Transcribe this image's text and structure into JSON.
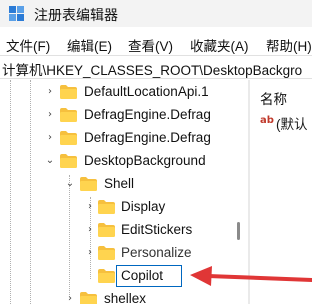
{
  "window": {
    "title": "注册表编辑器"
  },
  "menu": [
    {
      "label": "文件(F)"
    },
    {
      "label": "编辑(E)"
    },
    {
      "label": "查看(V)"
    },
    {
      "label": "收藏夹(A)"
    },
    {
      "label": "帮助(H)"
    }
  ],
  "address": {
    "path": "计算机\\HKEY_CLASSES_ROOT\\DesktopBackgro"
  },
  "tree": {
    "items": [
      {
        "label": "DefaultLocationApi.1"
      },
      {
        "label": "DefragEngine.Defrag"
      },
      {
        "label": "DefragEngine.Defrag"
      },
      {
        "label": "DesktopBackground"
      },
      {
        "label": "Shell"
      },
      {
        "label": "Display"
      },
      {
        "label": "EditStickers"
      },
      {
        "label": "Personalize"
      },
      {
        "label": "Copilot"
      },
      {
        "label": "shellex"
      }
    ]
  },
  "values_pane": {
    "header_name": "名称",
    "rows": [
      {
        "icon": "string-value-icon",
        "name": "(默认"
      }
    ]
  },
  "colors": {
    "folder": "#f6c03e",
    "arrow": "#e03636",
    "edit_border": "#0067c0"
  }
}
